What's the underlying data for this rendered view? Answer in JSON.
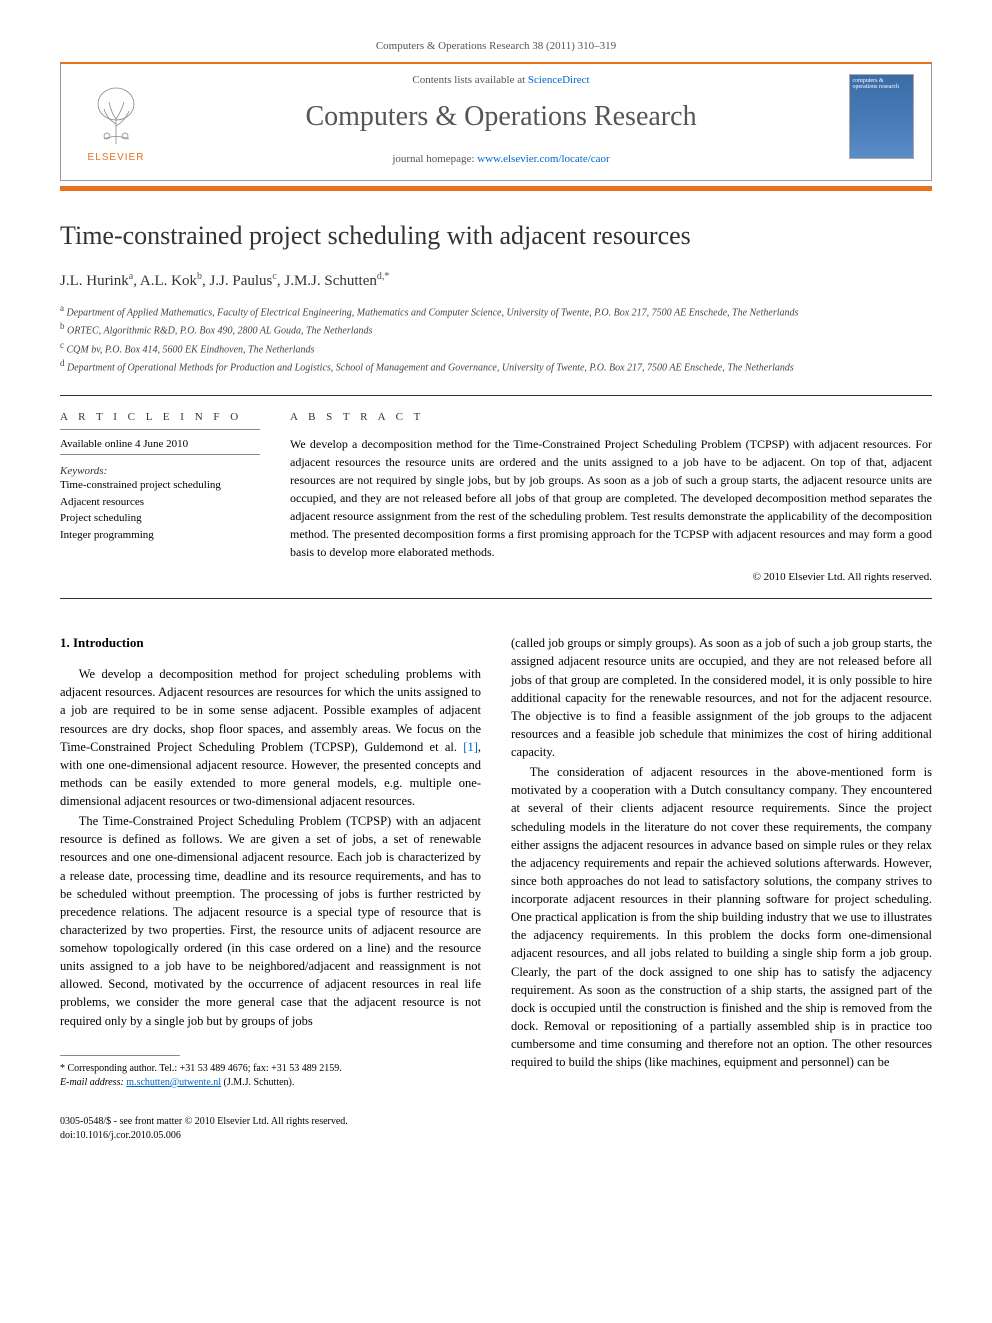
{
  "journal_ref": "Computers & Operations Research 38 (2011) 310–319",
  "header": {
    "contents_prefix": "Contents lists available at ",
    "contents_link": "ScienceDirect",
    "journal_name": "Computers & Operations Research",
    "homepage_prefix": "journal homepage: ",
    "homepage_link": "www.elsevier.com/locate/caor",
    "elsevier_label": "ELSEVIER",
    "cover_text": "computers & operations research"
  },
  "title": "Time-constrained project scheduling with adjacent resources",
  "authors_html": "J.L. Hurink ",
  "authors": [
    {
      "name": "J.L. Hurink",
      "sup": "a"
    },
    {
      "name": "A.L. Kok",
      "sup": "b"
    },
    {
      "name": "J.J. Paulus",
      "sup": "c"
    },
    {
      "name": "J.M.J. Schutten",
      "sup": "d,*"
    }
  ],
  "affiliations": [
    {
      "sup": "a",
      "text": "Department of Applied Mathematics, Faculty of Electrical Engineering, Mathematics and Computer Science, University of Twente, P.O. Box 217, 7500 AE Enschede, The Netherlands"
    },
    {
      "sup": "b",
      "text": "ORTEC, Algorithmic R&D, P.O. Box 490, 2800 AL Gouda, The Netherlands"
    },
    {
      "sup": "c",
      "text": "CQM bv, P.O. Box 414, 5600 EK Eindhoven, The Netherlands"
    },
    {
      "sup": "d",
      "text": "Department of Operational Methods for Production and Logistics, School of Management and Governance, University of Twente, P.O. Box 217, 7500 AE Enschede, The Netherlands"
    }
  ],
  "article_info": {
    "heading": "A R T I C L E   I N F O",
    "available": "Available online 4 June 2010",
    "keywords_label": "Keywords:",
    "keywords": [
      "Time-constrained project scheduling",
      "Adjacent resources",
      "Project scheduling",
      "Integer programming"
    ]
  },
  "abstract": {
    "heading": "A B S T R A C T",
    "text": "We develop a decomposition method for the Time-Constrained Project Scheduling Problem (TCPSP) with adjacent resources. For adjacent resources the resource units are ordered and the units assigned to a job have to be adjacent. On top of that, adjacent resources are not required by single jobs, but by job groups. As soon as a job of such a group starts, the adjacent resource units are occupied, and they are not released before all jobs of that group are completed. The developed decomposition method separates the adjacent resource assignment from the rest of the scheduling problem. Test results demonstrate the applicability of the decomposition method. The presented decomposition forms a first promising approach for the TCPSP with adjacent resources and may form a good basis to develop more elaborated methods.",
    "copyright": "© 2010 Elsevier Ltd. All rights reserved."
  },
  "body": {
    "section_heading": "1. Introduction",
    "col1_p1": "We develop a decomposition method for project scheduling problems with adjacent resources. Adjacent resources are resources for which the units assigned to a job are required to be in some sense adjacent. Possible examples of adjacent resources are dry docks, shop floor spaces, and assembly areas. We focus on the Time-Constrained Project Scheduling Problem (TCPSP), Guldemond et al. ",
    "col1_p1_ref": "[1]",
    "col1_p1_tail": ", with one one-dimensional adjacent resource. However, the presented concepts and methods can be easily extended to more general models, e.g. multiple one-dimensional adjacent resources or two-dimensional adjacent resources.",
    "col1_p2": "The Time-Constrained Project Scheduling Problem (TCPSP) with an adjacent resource is defined as follows. We are given a set of jobs, a set of renewable resources and one one-dimensional adjacent resource. Each job is characterized by a release date, processing time, deadline and its resource requirements, and has to be scheduled without preemption. The processing of jobs is further restricted by precedence relations. The adjacent resource is a special type of resource that is characterized by two properties. First, the resource units of adjacent resource are somehow topologically ordered (in this case ordered on a line) and the resource units assigned to a job have to be neighbored/adjacent and reassignment is not allowed. Second, motivated by the occurrence of adjacent resources in real life problems, we consider the more general case that the adjacent resource is not required only by a single job but by groups of jobs",
    "col2_p1": "(called job groups or simply groups). As soon as a job of such a job group starts, the assigned adjacent resource units are occupied, and they are not released before all jobs of that group are completed. In the considered model, it is only possible to hire additional capacity for the renewable resources, and not for the adjacent resource. The objective is to find a feasible assignment of the job groups to the adjacent resources and a feasible job schedule that minimizes the cost of hiring additional capacity.",
    "col2_p2": "The consideration of adjacent resources in the above-mentioned form is motivated by a cooperation with a Dutch consultancy company. They encountered at several of their clients adjacent resource requirements. Since the project scheduling models in the literature do not cover these requirements, the company either assigns the adjacent resources in advance based on simple rules or they relax the adjacency requirements and repair the achieved solutions afterwards. However, since both approaches do not lead to satisfactory solutions, the company strives to incorporate adjacent resources in their planning software for project scheduling. One practical application is from the ship building industry that we use to illustrates the adjacency requirements. In this problem the docks form one-dimensional adjacent resources, and all jobs related to building a single ship form a job group. Clearly, the part of the dock assigned to one ship has to satisfy the adjacency requirement. As soon as the construction of a ship starts, the assigned part of the dock is occupied until the construction is finished and the ship is removed from the dock. Removal or repositioning of a partially assembled ship is in practice too cumbersome and time consuming and therefore not an option. The other resources required to build the ships (like machines, equipment and personnel) can be"
  },
  "footnote": {
    "corr": "* Corresponding author. Tel.: +31 53 489 4676; fax: +31 53 489 2159.",
    "email_label": "E-mail address: ",
    "email": "m.schutten@utwente.nl",
    "email_tail": " (J.M.J. Schutten)."
  },
  "doi": {
    "line1": "0305-0548/$ - see front matter © 2010 Elsevier Ltd. All rights reserved.",
    "line2": "doi:10.1016/j.cor.2010.05.006"
  }
}
